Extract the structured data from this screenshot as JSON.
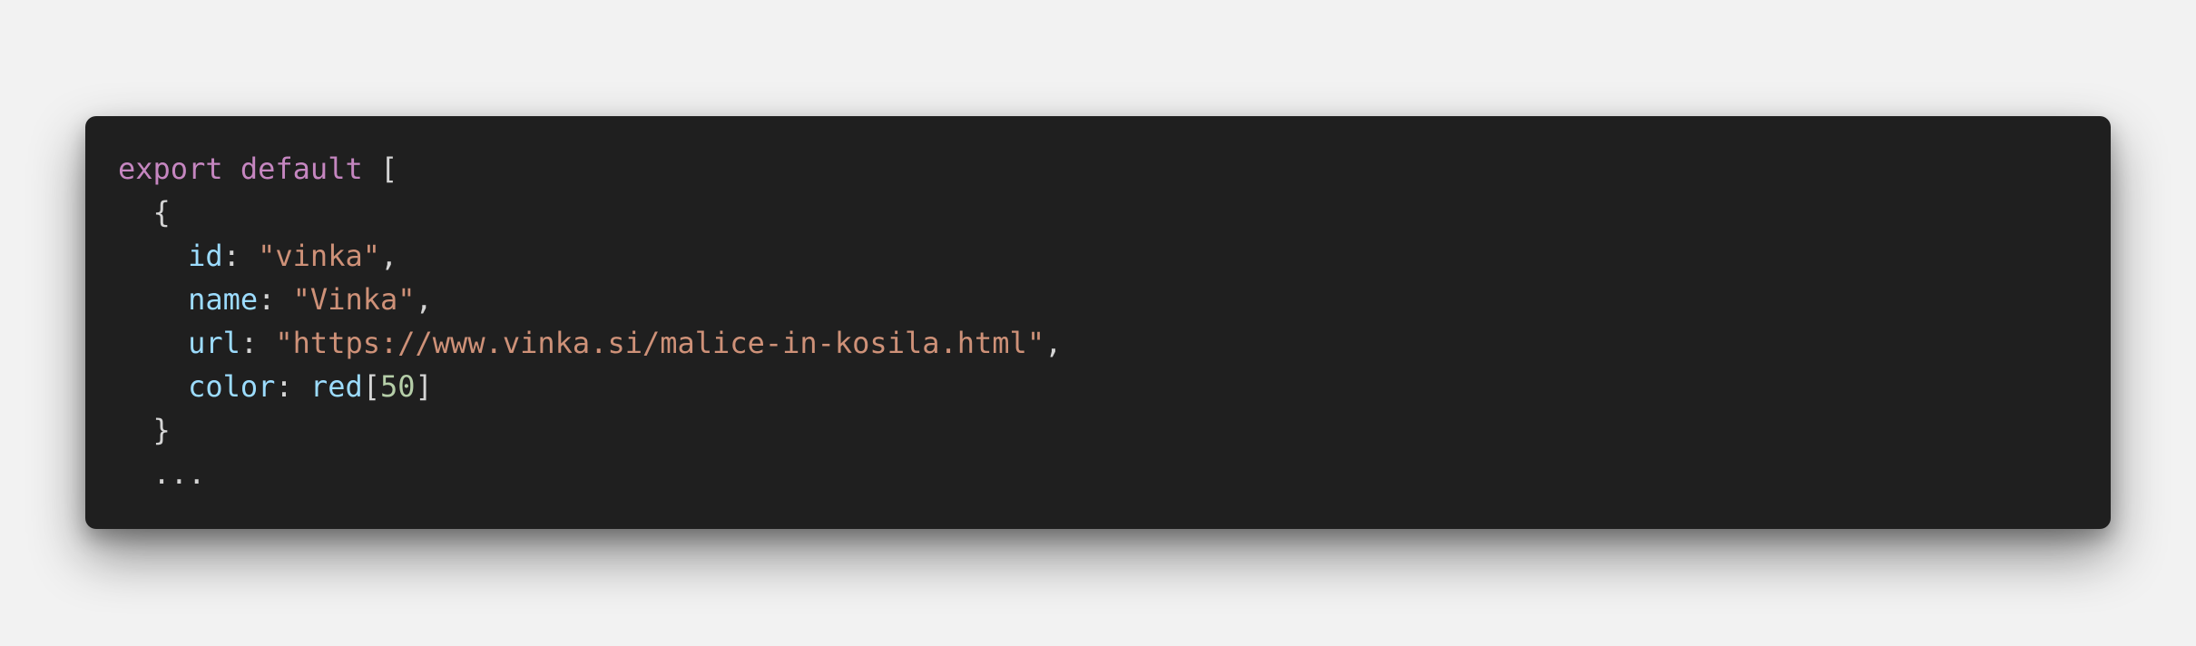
{
  "code": {
    "lines": [
      {
        "indent": "",
        "tokens": [
          {
            "text": "export",
            "kind": "kw"
          },
          {
            "text": " ",
            "kind": "punc"
          },
          {
            "text": "default",
            "kind": "kw"
          },
          {
            "text": " [",
            "kind": "punc"
          }
        ]
      },
      {
        "indent": "  ",
        "tokens": [
          {
            "text": "{",
            "kind": "punc"
          }
        ]
      },
      {
        "indent": "    ",
        "tokens": [
          {
            "text": "id",
            "kind": "prop"
          },
          {
            "text": ": ",
            "kind": "punc"
          },
          {
            "text": "\"vinka\"",
            "kind": "str"
          },
          {
            "text": ",",
            "kind": "punc"
          }
        ]
      },
      {
        "indent": "    ",
        "tokens": [
          {
            "text": "name",
            "kind": "prop"
          },
          {
            "text": ": ",
            "kind": "punc"
          },
          {
            "text": "\"Vinka\"",
            "kind": "str"
          },
          {
            "text": ",",
            "kind": "punc"
          }
        ]
      },
      {
        "indent": "    ",
        "tokens": [
          {
            "text": "url",
            "kind": "prop"
          },
          {
            "text": ": ",
            "kind": "punc"
          },
          {
            "text": "\"https://www.vinka.si/malice-in-kosila.html\"",
            "kind": "str"
          },
          {
            "text": ",",
            "kind": "punc"
          }
        ]
      },
      {
        "indent": "    ",
        "tokens": [
          {
            "text": "color",
            "kind": "prop"
          },
          {
            "text": ": ",
            "kind": "punc"
          },
          {
            "text": "red",
            "kind": "prop"
          },
          {
            "text": "[",
            "kind": "punc"
          },
          {
            "text": "50",
            "kind": "num"
          },
          {
            "text": "]",
            "kind": "punc"
          }
        ]
      },
      {
        "indent": "  ",
        "tokens": [
          {
            "text": "}",
            "kind": "punc"
          }
        ]
      },
      {
        "indent": "  ",
        "tokens": [
          {
            "text": "...",
            "kind": "punc"
          }
        ]
      }
    ]
  },
  "colors": {
    "page_background": "#f2f2f2",
    "editor_background": "#1f1f1f",
    "keyword": "#c586c0",
    "property": "#9cdcfe",
    "string": "#ce9178",
    "number": "#b5cea8",
    "punctuation": "#d4d4d4"
  }
}
